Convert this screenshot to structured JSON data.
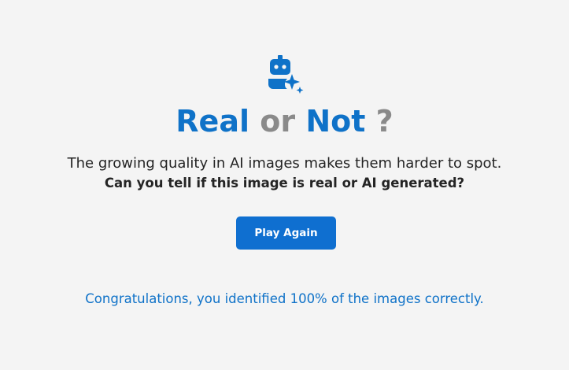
{
  "title": {
    "word1": "Real",
    "word2": "or",
    "word3": "Not",
    "mark": "?"
  },
  "description": "The growing quality in AI images makes them harder to spot.",
  "question": "Can you tell if this image is real or AI generated?",
  "play_again_label": "Play Again",
  "result_message": "Congratulations, you identified 100% of the images correctly.",
  "logo_icon": "bot-sparkle-icon",
  "colors": {
    "accent": "#0f72c8",
    "muted": "#8a8a8a",
    "button": "#0f6fd0",
    "background": "#f4f4f4",
    "text": "#242424"
  }
}
